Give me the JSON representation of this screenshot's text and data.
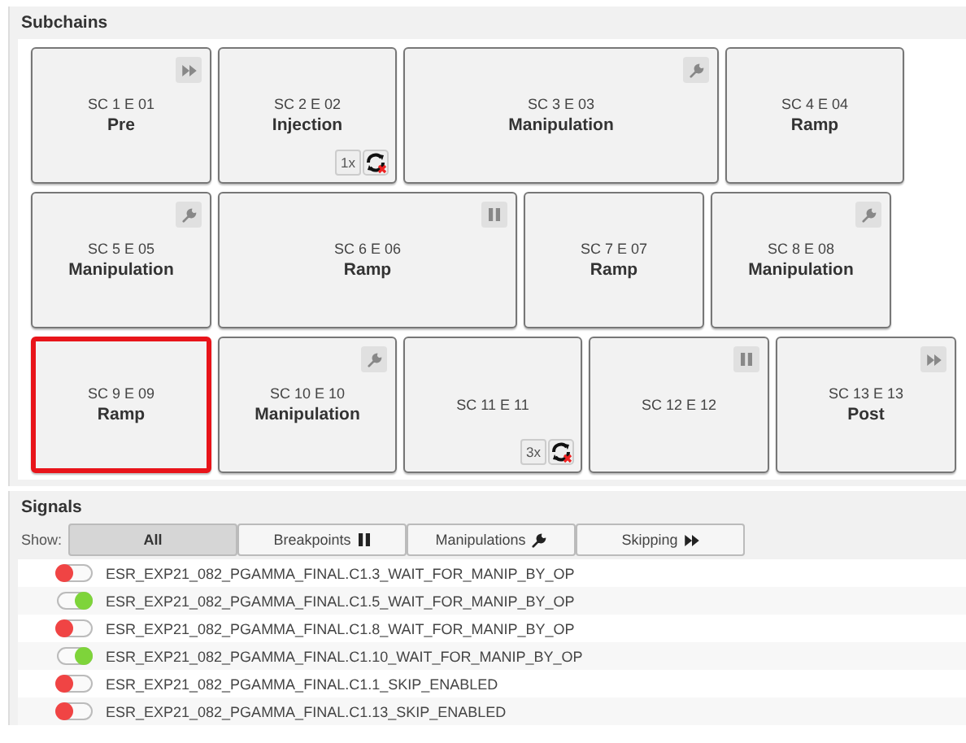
{
  "subchains": {
    "title": "Subchains",
    "rows": [
      [
        {
          "code": "SC 1 E 01",
          "name": "Pre",
          "kind": "skip",
          "selected": false
        },
        {
          "code": "SC 2 E 02",
          "name": "Injection",
          "repeat": "1x",
          "selected": false
        },
        {
          "code": "SC 3 E 03",
          "name": "Manipulation",
          "kind": "manipulation",
          "selected": false
        },
        {
          "code": "SC 4 E 04",
          "name": "Ramp",
          "selected": false
        }
      ],
      [
        {
          "code": "SC 5 E 05",
          "name": "Manipulation",
          "kind": "manipulation",
          "selected": false
        },
        {
          "code": "SC 6 E 06",
          "name": "Ramp",
          "kind": "breakpoint",
          "selected": false
        },
        {
          "code": "SC 7 E 07",
          "name": "Ramp",
          "selected": false
        },
        {
          "code": "SC 8 E 08",
          "name": "Manipulation",
          "kind": "manipulation",
          "selected": false
        }
      ],
      [
        {
          "code": "SC 9 E 09",
          "name": "Ramp",
          "selected": true
        },
        {
          "code": "SC 10 E 10",
          "name": "Manipulation",
          "kind": "manipulation",
          "selected": false
        },
        {
          "code": "SC 11 E 11",
          "repeat": "3x",
          "selected": false
        },
        {
          "code": "SC 12 E 12",
          "kind": "breakpoint",
          "selected": false
        },
        {
          "code": "SC 13 E 13",
          "name": "Post",
          "kind": "skip",
          "selected": false
        }
      ]
    ]
  },
  "signals": {
    "title": "Signals",
    "show_label": "Show:",
    "filters": [
      {
        "label": "All",
        "selected": true
      },
      {
        "label": "Breakpoints",
        "kind": "breakpoint",
        "selected": false
      },
      {
        "label": "Manipulations",
        "kind": "manipulation",
        "selected": false
      },
      {
        "label": "Skipping",
        "kind": "skip",
        "selected": false
      }
    ],
    "items": [
      {
        "name": "ESR_EXP21_082_PGAMMA_FINAL.C1.3_WAIT_FOR_MANIP_BY_OP",
        "on": false
      },
      {
        "name": "ESR_EXP21_082_PGAMMA_FINAL.C1.5_WAIT_FOR_MANIP_BY_OP",
        "on": true
      },
      {
        "name": "ESR_EXP21_082_PGAMMA_FINAL.C1.8_WAIT_FOR_MANIP_BY_OP",
        "on": false
      },
      {
        "name": "ESR_EXP21_082_PGAMMA_FINAL.C1.10_WAIT_FOR_MANIP_BY_OP",
        "on": true
      },
      {
        "name": "ESR_EXP21_082_PGAMMA_FINAL.C1.1_SKIP_ENABLED",
        "on": false
      },
      {
        "name": "ESR_EXP21_082_PGAMMA_FINAL.C1.13_SKIP_ENABLED",
        "on": false
      }
    ]
  }
}
